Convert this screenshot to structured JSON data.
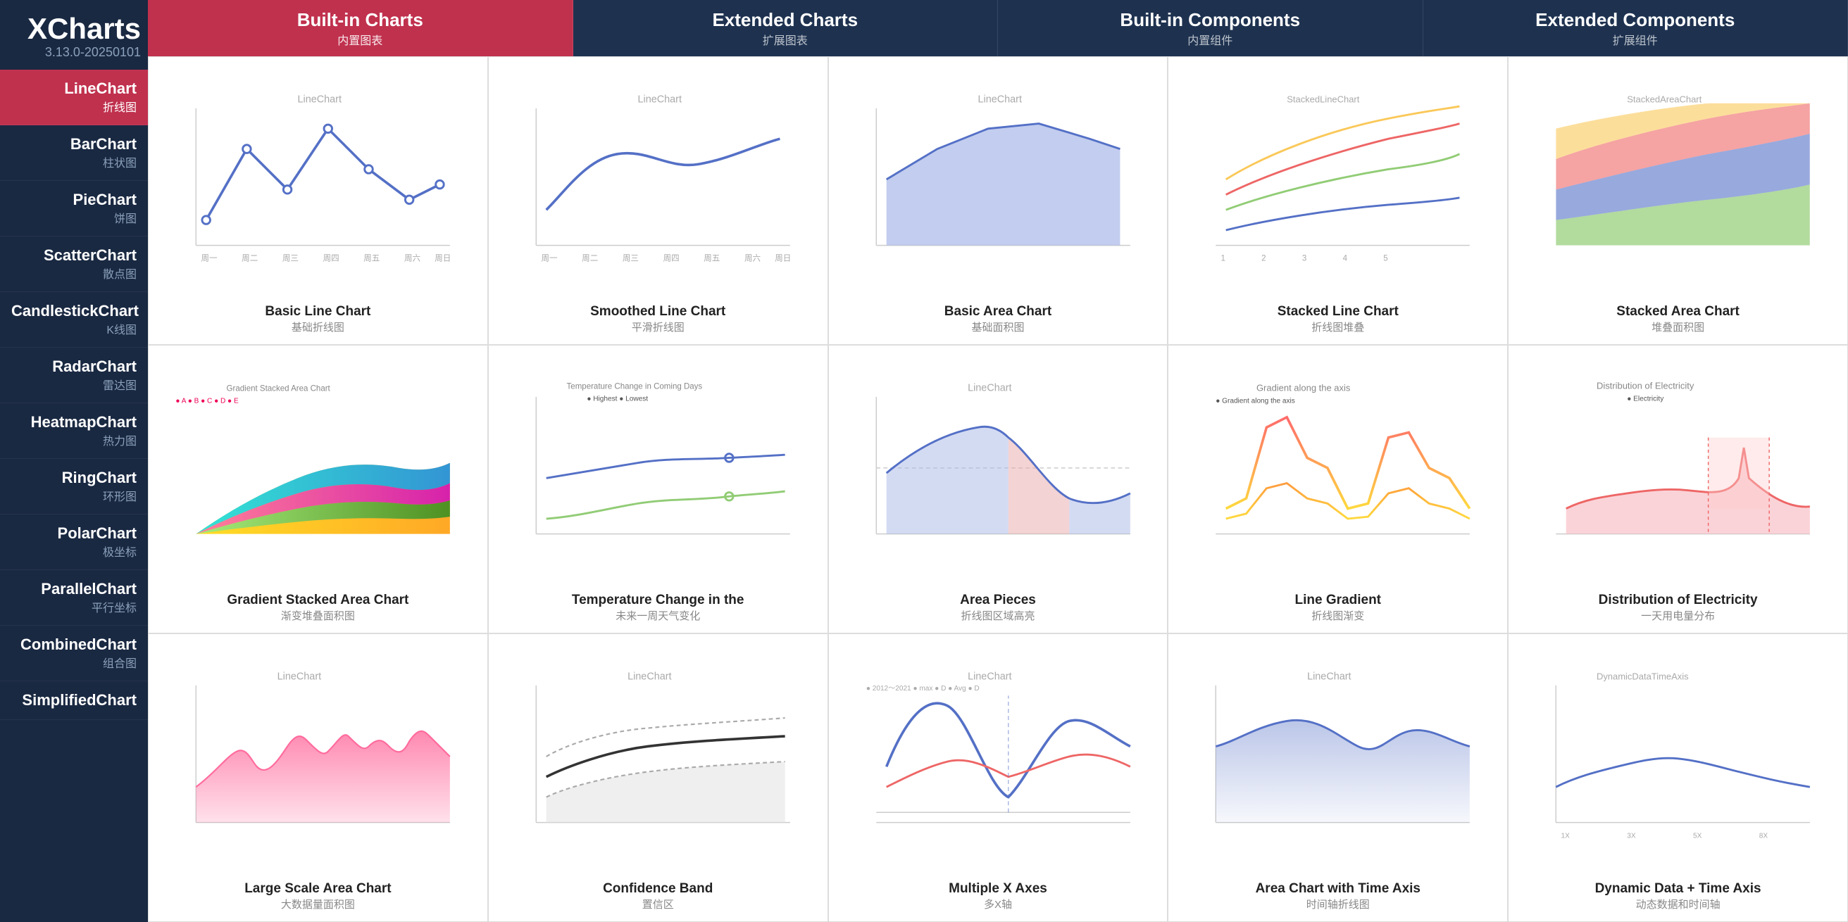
{
  "logo": {
    "title": "XCharts",
    "version": "3.13.0-20250101"
  },
  "sidebar": {
    "items": [
      {
        "main": "LineChart",
        "sub": "折线图",
        "active": true
      },
      {
        "main": "BarChart",
        "sub": "柱状图",
        "active": false
      },
      {
        "main": "PieChart",
        "sub": "饼图",
        "active": false
      },
      {
        "main": "ScatterChart",
        "sub": "散点图",
        "active": false
      },
      {
        "main": "CandlestickChart",
        "sub": "K线图",
        "active": false
      },
      {
        "main": "RadarChart",
        "sub": "雷达图",
        "active": false
      },
      {
        "main": "HeatmapChart",
        "sub": "热力图",
        "active": false
      },
      {
        "main": "RingChart",
        "sub": "环形图",
        "active": false
      },
      {
        "main": "PolarChart",
        "sub": "极坐标",
        "active": false
      },
      {
        "main": "ParallelChart",
        "sub": "平行坐标",
        "active": false
      },
      {
        "main": "CombinedChart",
        "sub": "组合图",
        "active": false
      },
      {
        "main": "SimplifiedChart",
        "sub": "",
        "active": false
      }
    ]
  },
  "tabs": [
    {
      "main": "Built-in Charts",
      "sub": "内置图表",
      "active": true
    },
    {
      "main": "Extended Charts",
      "sub": "扩展图表",
      "active": false
    },
    {
      "main": "Built-in Components",
      "sub": "内置组件",
      "active": false
    },
    {
      "main": "Extended Components",
      "sub": "扩展组件",
      "active": false
    }
  ],
  "charts": [
    {
      "title_en": "Basic Line Chart",
      "title_zh": "基础折线图",
      "type": "basic_line"
    },
    {
      "title_en": "Smoothed Line Chart",
      "title_zh": "平滑折线图",
      "type": "smooth_line"
    },
    {
      "title_en": "Basic Area Chart",
      "title_zh": "基础面积图",
      "type": "basic_area"
    },
    {
      "title_en": "Stacked Line Chart",
      "title_zh": "折线图堆叠",
      "type": "stacked_line"
    },
    {
      "title_en": "Stacked Area Chart",
      "title_zh": "堆叠面积图",
      "type": "stacked_area"
    },
    {
      "title_en": "Gradient Stacked Area Chart",
      "title_zh": "渐变堆叠面积图",
      "type": "gradient_stacked"
    },
    {
      "title_en": "Temperature Change in the",
      "title_zh": "未来一周天气变化",
      "type": "temperature"
    },
    {
      "title_en": "Area Pieces",
      "title_zh": "折线图区域高亮",
      "type": "area_pieces"
    },
    {
      "title_en": "Line Gradient",
      "title_zh": "折线图渐变",
      "type": "line_gradient"
    },
    {
      "title_en": "Distribution of Electricity",
      "title_zh": "一天用电量分布",
      "type": "electricity"
    },
    {
      "title_en": "Large Scale Area Chart",
      "title_zh": "大数据量面积图",
      "type": "large_scale"
    },
    {
      "title_en": "Confidence Band",
      "title_zh": "置信区",
      "type": "confidence"
    },
    {
      "title_en": "Multiple X Axes",
      "title_zh": "多X轴",
      "type": "multi_x"
    },
    {
      "title_en": "Area Chart with Time Axis",
      "title_zh": "时间轴折线图",
      "type": "time_axis"
    },
    {
      "title_en": "Dynamic Data + Time Axis",
      "title_zh": "动态数据和时间轴",
      "type": "dynamic_time"
    }
  ]
}
